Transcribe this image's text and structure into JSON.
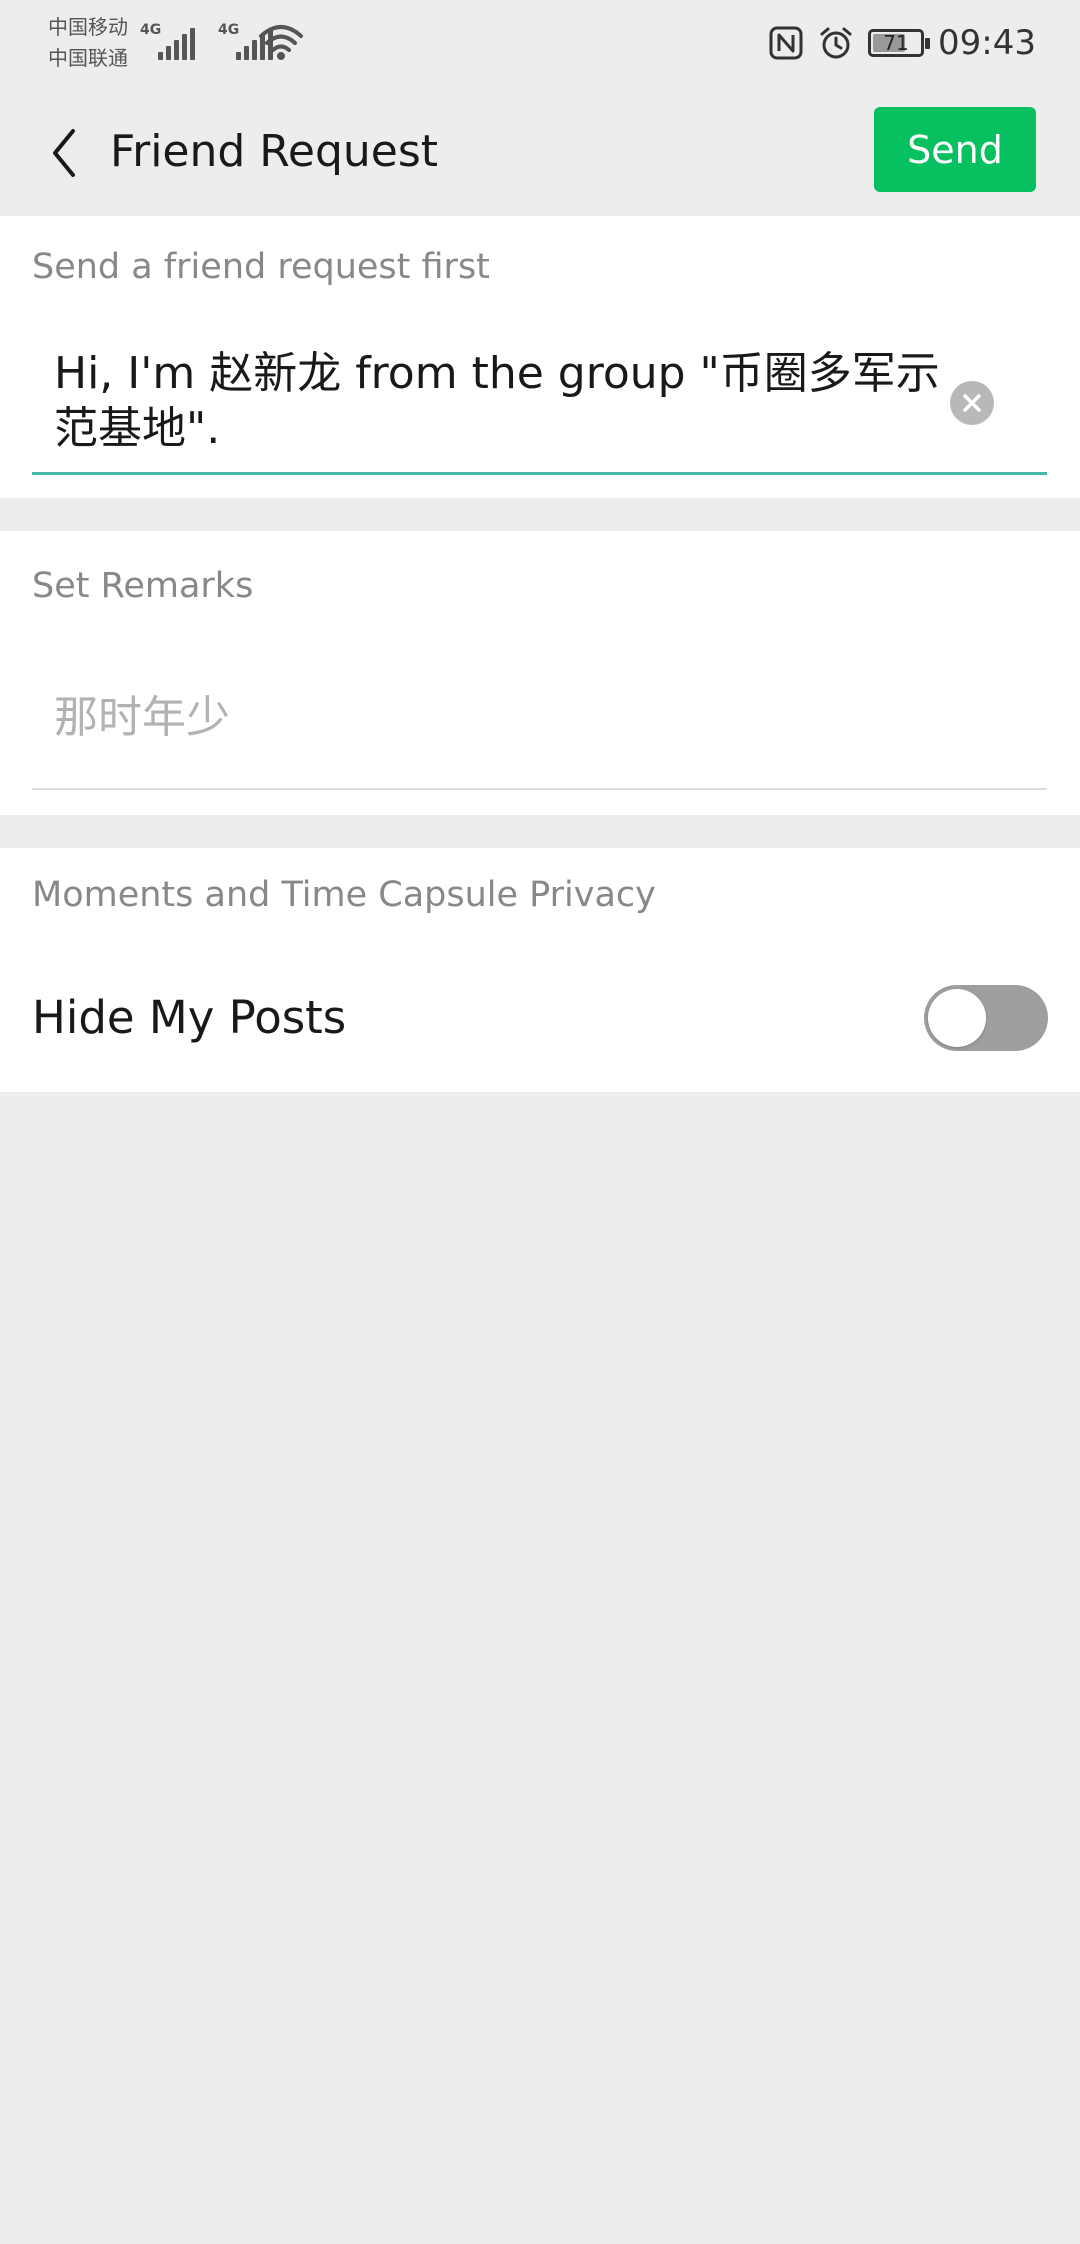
{
  "status_bar": {
    "carrier_1": "中国移动",
    "carrier_2": "中国联通",
    "network_1": "4G",
    "network_2": "4G",
    "battery_level": "71",
    "time": "09:43",
    "icons": [
      "signal-icon",
      "wifi-icon",
      "nfc-icon",
      "alarm-icon",
      "battery-icon"
    ]
  },
  "nav": {
    "back_icon": "chevron-left-icon",
    "title": "Friend Request",
    "send_label": "Send",
    "accent_color": "#07c160"
  },
  "request": {
    "label": "Send a friend request first",
    "message": "Hi, I'm 赵新龙 from the group \"币圈多军示范基地\".",
    "clear_icon": "clear-circle-icon"
  },
  "remarks": {
    "label": "Set Remarks",
    "placeholder": "那时年少",
    "value": ""
  },
  "privacy": {
    "label": "Moments and Time Capsule Privacy",
    "hide_posts_label": "Hide My Posts",
    "hide_posts_enabled": false
  }
}
